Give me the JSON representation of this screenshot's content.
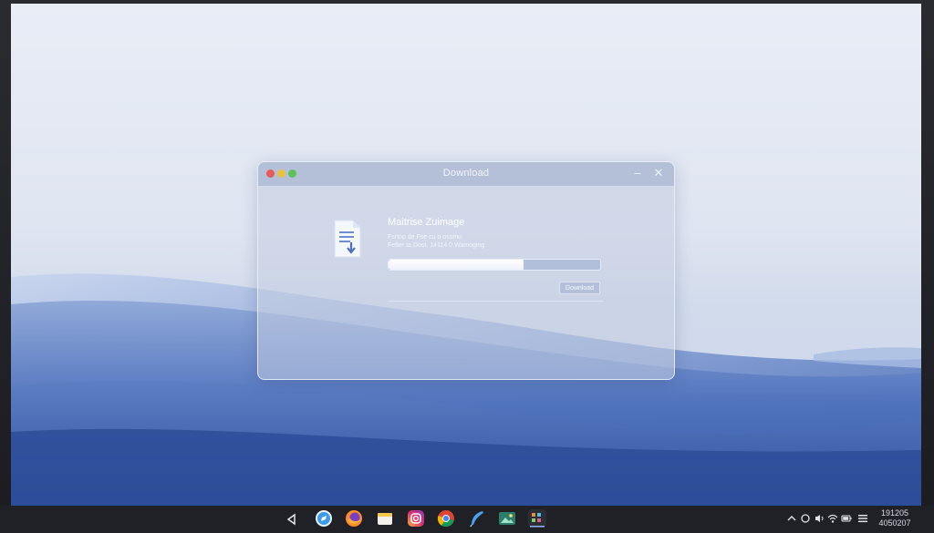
{
  "dialog": {
    "title": "Download",
    "minimize_glyph": "–",
    "close_glyph": "✕",
    "file_name": "Maitrise Zuimage",
    "file_info_line1": "Fsrtop de Fse cu o ossmo",
    "file_info_line2": "Fefter ta Dost. 14114 0 Wamoging",
    "progress_fraction": 0.64,
    "button_label": "Download",
    "file_icon": "document-download-icon"
  },
  "taskbar": {
    "items": [
      {
        "name": "back-icon"
      },
      {
        "name": "safari-icon"
      },
      {
        "name": "firefox-icon"
      },
      {
        "name": "file-manager-icon"
      },
      {
        "name": "instagram-icon"
      },
      {
        "name": "chrome-icon"
      },
      {
        "name": "feather-icon"
      },
      {
        "name": "photo-viewer-icon"
      },
      {
        "name": "app-grid-icon"
      }
    ],
    "tray": [
      {
        "name": "chevron-up-icon"
      },
      {
        "name": "circle-icon"
      },
      {
        "name": "audio-icon"
      },
      {
        "name": "wifi-icon"
      },
      {
        "name": "battery-icon"
      },
      {
        "name": "menu-icon"
      }
    ],
    "clock_time": "191205",
    "clock_date": "4050207"
  },
  "colors": {
    "wallpaper_sky": "#e6ebf5",
    "wallpaper_wave": "#3d63b1",
    "taskbar": "#1f2127"
  }
}
